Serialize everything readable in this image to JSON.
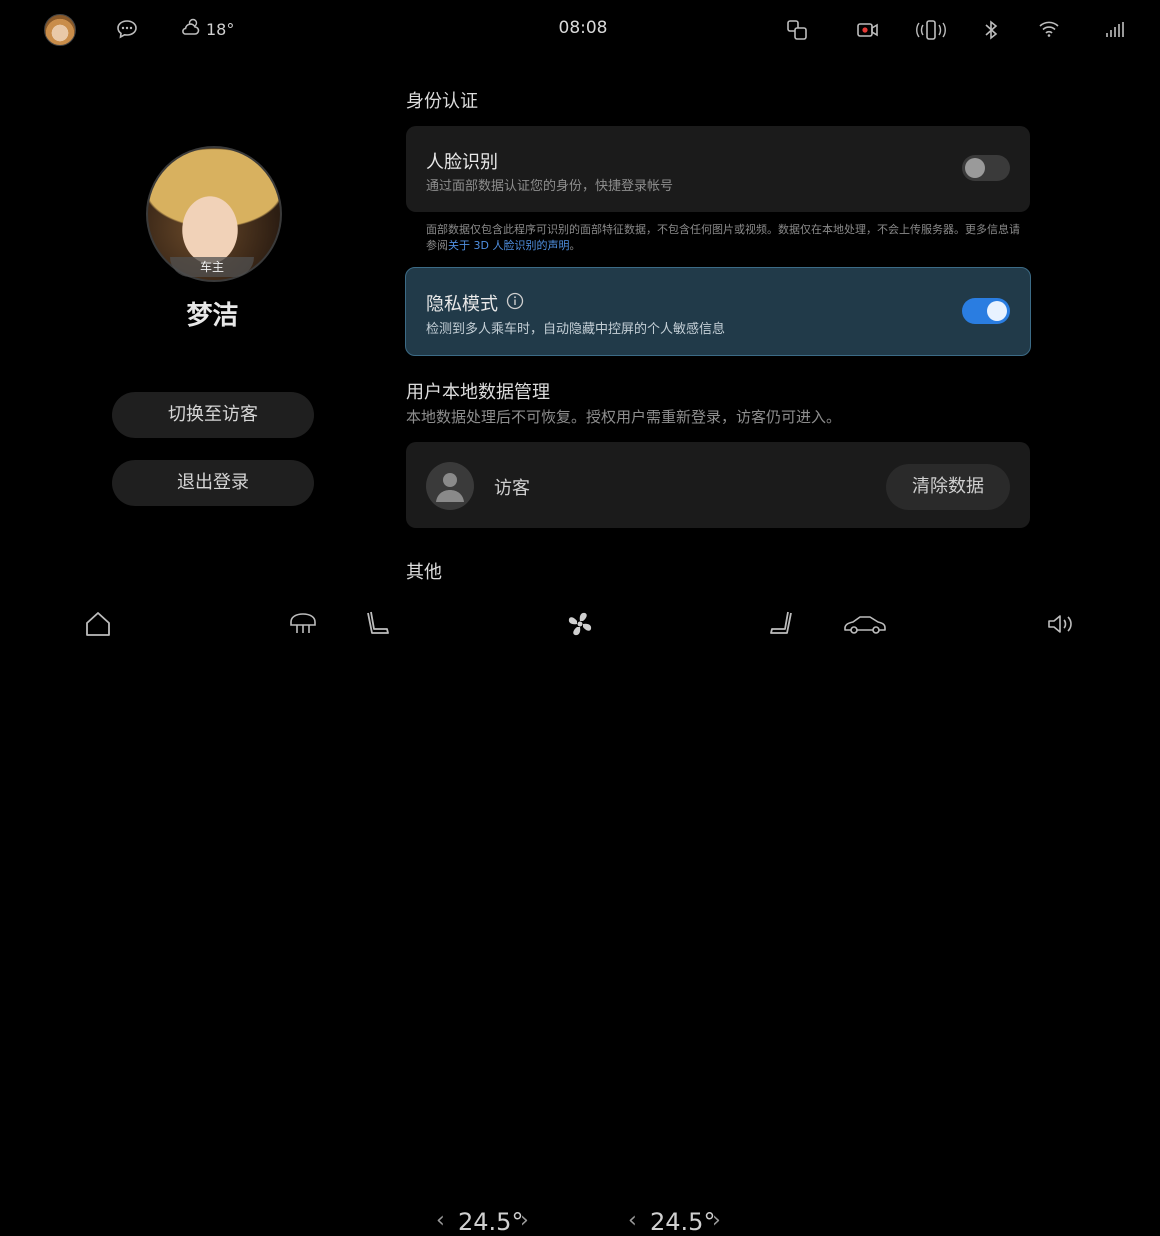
{
  "status_bar": {
    "weather_temp": "18°",
    "time": "08:08",
    "icons": [
      "message-icon",
      "weather-icon",
      "screen-cast-icon",
      "recording-camera-icon",
      "vibrate-icon",
      "bluetooth-icon",
      "wifi-icon",
      "signal-icon"
    ]
  },
  "profile": {
    "avatar_tag": "车主",
    "name": "梦洁",
    "switch_guest_label": "切换至访客",
    "logout_label": "退出登录"
  },
  "identity": {
    "section_title": "身份认证",
    "face": {
      "title": "人脸识别",
      "subtitle": "通过面部数据认证您的身份，快捷登录帐号",
      "enabled": false
    },
    "note": "面部数据仅包含此程序可识别的面部特征数据，不包含任何图片或视频。数据仅在本地处理，不会上传服务器。更多信息请参阅",
    "note_link": "关于 3D 人脸识别的声明",
    "note_end": "。",
    "privacy": {
      "title": "隐私模式",
      "subtitle": "检测到多人乘车时，自动隐藏中控屏的个人敏感信息",
      "enabled": true
    }
  },
  "local_data": {
    "section_title": "用户本地数据管理",
    "subtitle": "本地数据处理后不可恢复。授权用户需重新登录，访客仍可进入。",
    "guest_label": "访客",
    "clear_label": "清除数据"
  },
  "other": {
    "section_title": "其他"
  },
  "bottom_bar": {
    "left_temp": "24.5°",
    "right_temp": "24.5°",
    "prev_chevron": "‹",
    "next_chevron": "›",
    "icons": [
      "home-icon",
      "rear-defrost-icon",
      "seat-heat-icon",
      "fan-icon",
      "seat-vent-icon",
      "car-icon",
      "volume-icon"
    ]
  },
  "colors": {
    "accent": "#2a7de1",
    "privacy_bg": "#213a49",
    "link": "#4f8fe0"
  }
}
